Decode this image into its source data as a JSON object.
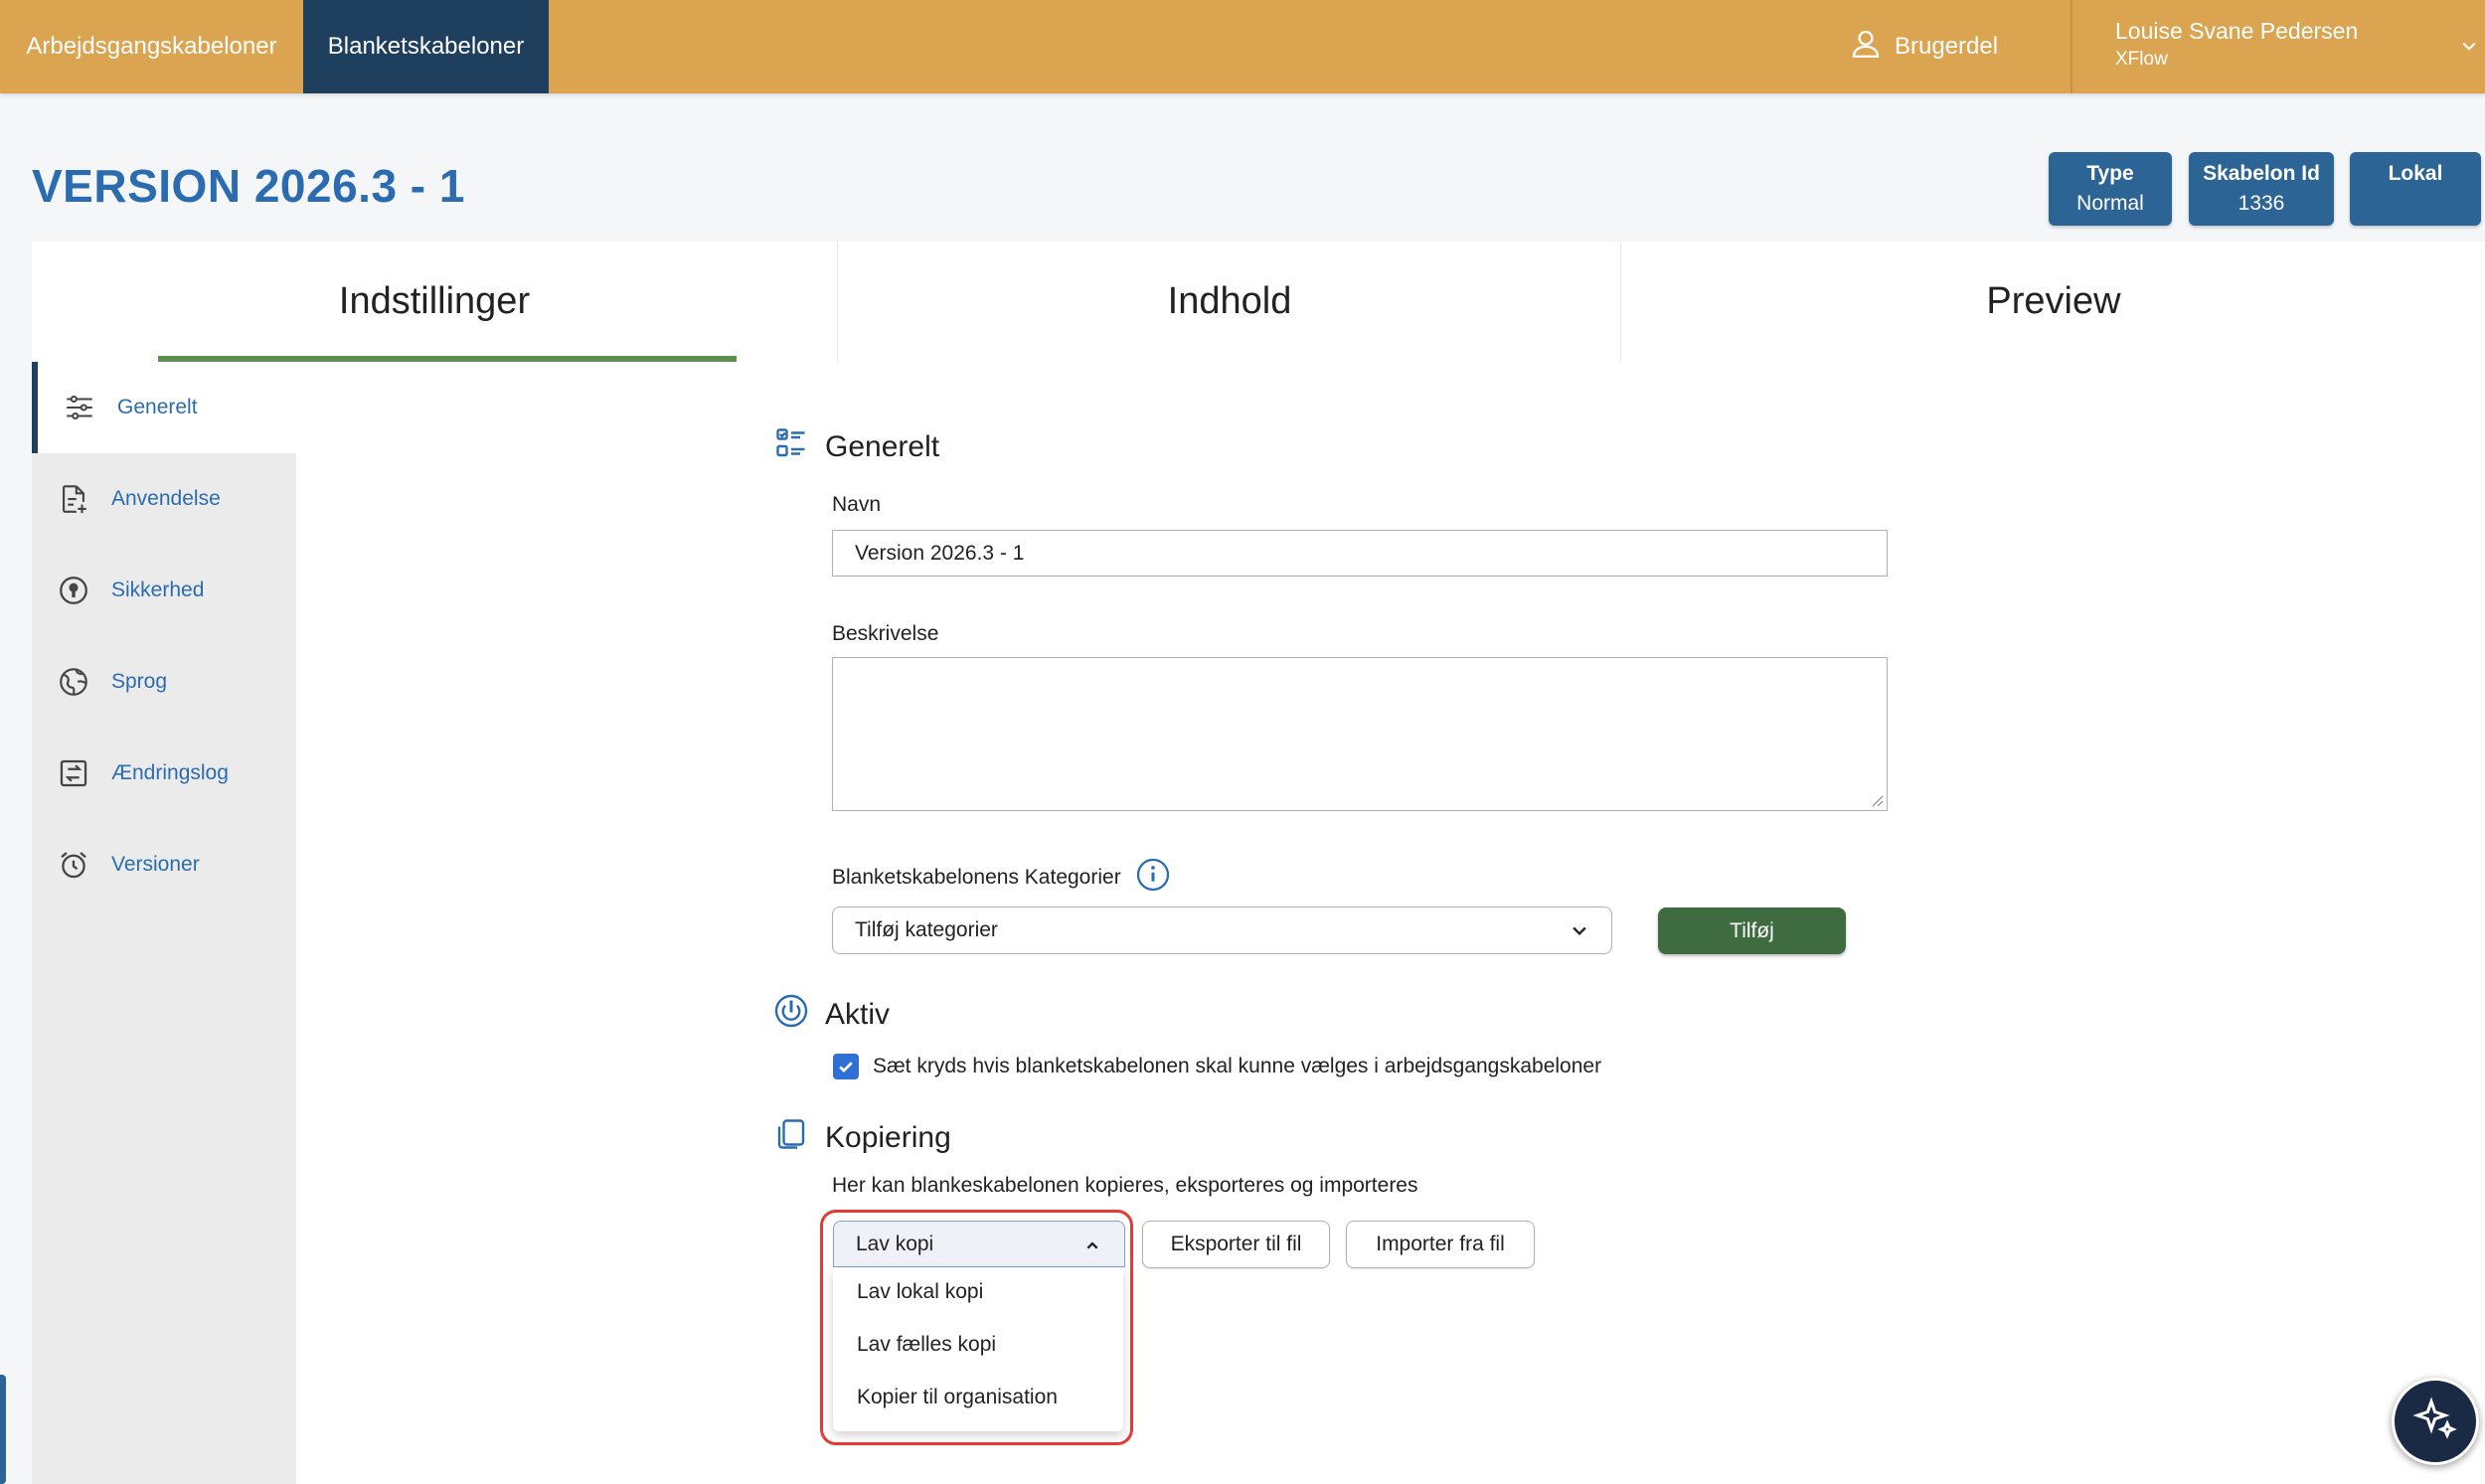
{
  "topbar": {
    "tab1": "Arbejdsgangskabeloner",
    "tab2": "Blanketskabeloner",
    "brugerdel": "Brugerdel",
    "user_name": "Louise Svane Pedersen",
    "user_org": "XFlow"
  },
  "page": {
    "title": "VERSION 2026.3 - 1",
    "badges": [
      {
        "label": "Type",
        "value": "Normal"
      },
      {
        "label": "Skabelon Id",
        "value": "1336"
      },
      {
        "label": "Lokal",
        "value": ""
      }
    ]
  },
  "tabs": [
    "Indstillinger",
    "Indhold",
    "Preview"
  ],
  "sidebar": {
    "items": [
      {
        "label": "Generelt",
        "icon": "sliders-icon"
      },
      {
        "label": "Anvendelse",
        "icon": "document-add-icon"
      },
      {
        "label": "Sikkerhed",
        "icon": "keyhole-icon"
      },
      {
        "label": "Sprog",
        "icon": "globe-icon"
      },
      {
        "label": "Ændringslog",
        "icon": "swap-icon"
      },
      {
        "label": "Versioner",
        "icon": "alarm-clock-icon"
      }
    ]
  },
  "generelt": {
    "heading": "Generelt",
    "navn_label": "Navn",
    "navn_value": "Version 2026.3 - 1",
    "beskrivelse_label": "Beskrivelse",
    "beskrivelse_value": "",
    "kategorier_label": "Blanketskabelonens Kategorier",
    "kategorier_placeholder": "Tilføj kategorier",
    "add_button": "Tilføj"
  },
  "aktiv": {
    "heading": "Aktiv",
    "checkbox_label": "Sæt kryds hvis blanketskabelonen skal kunne vælges i arbejdsgangskabeloner",
    "checked": true
  },
  "kopiering": {
    "heading": "Kopiering",
    "description": "Her kan blankeskabelonen kopieres, eksporteres og importeres",
    "copy_dropdown": "Lav kopi",
    "export_button": "Eksporter til fil",
    "import_button": "Importer fra fil",
    "options": [
      "Lav lokal kopi",
      "Lav fælles kopi",
      "Kopier til organisation"
    ]
  },
  "colors": {
    "topbar": "#dba450",
    "active_tab": "#1f3f5f",
    "accent_blue": "#2b6cb0",
    "badge": "#2d6496",
    "green": "#3f6b40",
    "highlight": "#e53935"
  }
}
